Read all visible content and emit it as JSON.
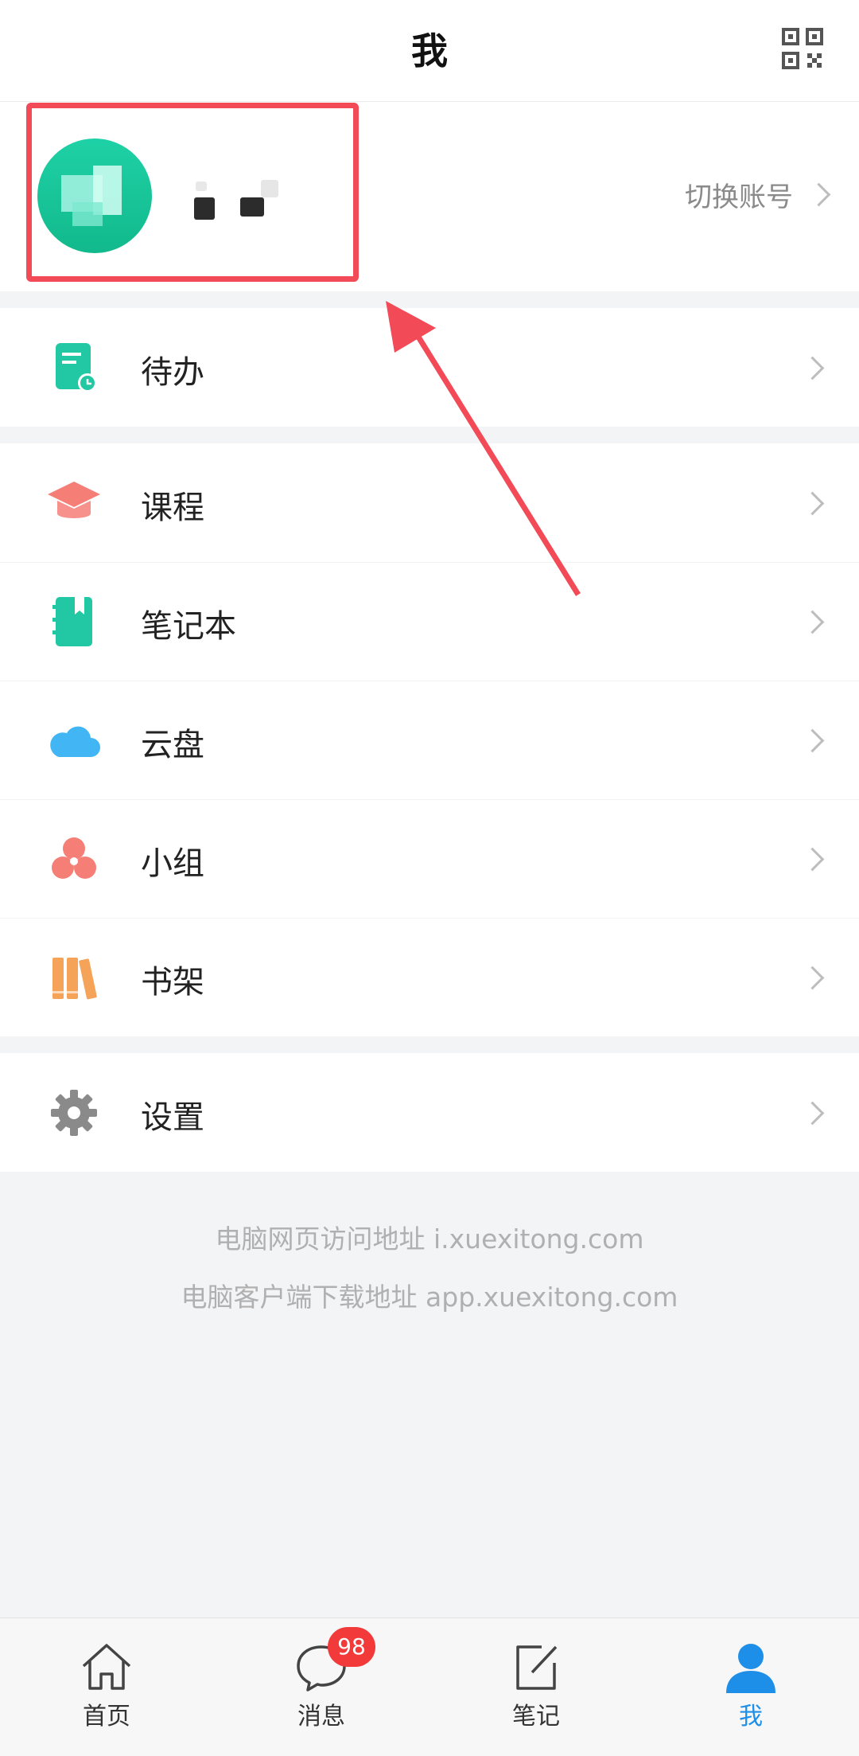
{
  "header": {
    "title": "我",
    "qr_icon": "qr-code-icon"
  },
  "profile": {
    "switch_label": "切换账号"
  },
  "groups": [
    {
      "items": [
        {
          "label": "待办",
          "icon": "todo-icon",
          "color": "#22c7a3"
        }
      ]
    },
    {
      "items": [
        {
          "label": "课程",
          "icon": "course-icon",
          "color": "#f57f77"
        },
        {
          "label": "笔记本",
          "icon": "notebook-icon",
          "color": "#22c7a3"
        },
        {
          "label": "云盘",
          "icon": "cloud-icon",
          "color": "#42b6f5"
        },
        {
          "label": "小组",
          "icon": "group-icon",
          "color": "#f57f77"
        },
        {
          "label": "书架",
          "icon": "bookshelf-icon",
          "color": "#f5a359"
        }
      ]
    },
    {
      "items": [
        {
          "label": "设置",
          "icon": "gear-icon",
          "color": "#8a8a8a"
        }
      ]
    }
  ],
  "links": {
    "web": "电脑网页访问地址 i.xuexitong.com",
    "client": "电脑客户端下载地址 app.xuexitong.com"
  },
  "tabbar": {
    "tabs": [
      {
        "label": "首页",
        "icon": "home-icon"
      },
      {
        "label": "消息",
        "icon": "message-icon"
      },
      {
        "label": "笔记",
        "icon": "note-icon"
      },
      {
        "label": "我",
        "icon": "user-icon",
        "active": true
      }
    ],
    "message_badge": "98"
  },
  "colors": {
    "accent": "#1e8fe8",
    "highlight": "#f24a57",
    "badge": "#f23a3a"
  }
}
